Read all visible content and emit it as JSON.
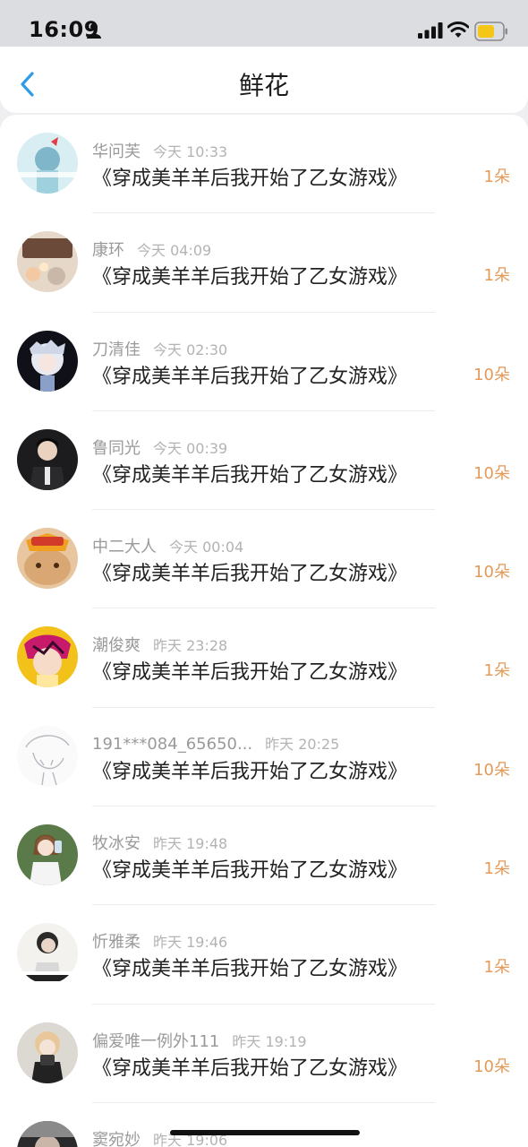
{
  "status_bar": {
    "time": "16:09"
  },
  "header": {
    "title": "鲜花"
  },
  "items": [
    {
      "user": "华问芙",
      "time": "今天 10:33",
      "book": "《穿成美羊羊后我开始了乙女游戏》",
      "count": "1朵"
    },
    {
      "user": "康环",
      "time": "今天 04:09",
      "book": "《穿成美羊羊后我开始了乙女游戏》",
      "count": "1朵"
    },
    {
      "user": "刀清佳",
      "time": "今天 02:30",
      "book": "《穿成美羊羊后我开始了乙女游戏》",
      "count": "10朵"
    },
    {
      "user": "鲁同光",
      "time": "今天 00:39",
      "book": "《穿成美羊羊后我开始了乙女游戏》",
      "count": "10朵"
    },
    {
      "user": "中二大人",
      "time": "今天 00:04",
      "book": "《穿成美羊羊后我开始了乙女游戏》",
      "count": "10朵"
    },
    {
      "user": "潮俊爽",
      "time": "昨天 23:28",
      "book": "《穿成美羊羊后我开始了乙女游戏》",
      "count": "1朵"
    },
    {
      "user": "191***084_65650...",
      "time": "昨天 20:25",
      "book": "《穿成美羊羊后我开始了乙女游戏》",
      "count": "10朵"
    },
    {
      "user": "牧冰安",
      "time": "昨天 19:48",
      "book": "《穿成美羊羊后我开始了乙女游戏》",
      "count": "1朵"
    },
    {
      "user": "忻雅柔",
      "time": "昨天 19:46",
      "book": "《穿成美羊羊后我开始了乙女游戏》",
      "count": "1朵"
    },
    {
      "user": "偏爱唯一例外111",
      "time": "昨天 19:19",
      "book": "《穿成美羊羊后我开始了乙女游戏》",
      "count": "10朵"
    },
    {
      "user": "窦宛妙",
      "time": "昨天 19:06",
      "book": "",
      "count": ""
    }
  ]
}
